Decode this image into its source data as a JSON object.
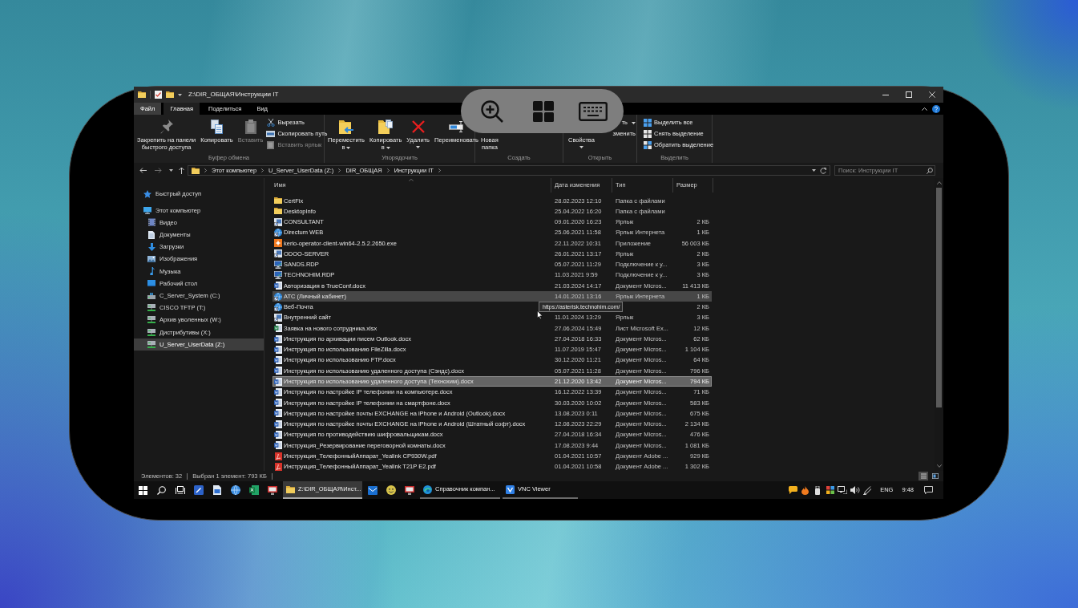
{
  "window": {
    "title": "Z:\\DIR_ОБЩАЯ\\Инструкции IT"
  },
  "ribbon": {
    "tabs": [
      {
        "label": "Файл",
        "kind": "file",
        "selected": false
      },
      {
        "label": "Главная",
        "kind": "tab",
        "selected": true
      },
      {
        "label": "Поделиться",
        "kind": "tab",
        "selected": false
      },
      {
        "label": "Вид",
        "kind": "tab",
        "selected": false
      }
    ],
    "groups": [
      {
        "label": "Буфер обмена",
        "large": [
          {
            "label": "Закрепить на панели\nбыстрого доступа",
            "kind": "pin",
            "disabled": false
          },
          {
            "label": "Копировать",
            "kind": "copy",
            "disabled": false
          },
          {
            "label": "Вставить",
            "kind": "paste",
            "disabled": true
          }
        ],
        "small": [
          {
            "label": "Вырезать",
            "kind": "cut",
            "disabled": false
          },
          {
            "label": "Скопировать путь",
            "kind": "copy-path",
            "disabled": false
          },
          {
            "label": "Вставить ярлык",
            "kind": "paste-shortcut",
            "disabled": true
          }
        ]
      },
      {
        "label": "Упорядочить",
        "large": [
          {
            "label": "Переместить\nв",
            "kind": "move-to",
            "dropdown": true,
            "disabled": false
          },
          {
            "label": "Копировать\nв",
            "kind": "copy-to",
            "dropdown": true,
            "disabled": false
          },
          {
            "label": "Удалить",
            "kind": "delete",
            "dropdown": true,
            "disabled": false
          },
          {
            "label": "Переименовать",
            "kind": "rename",
            "disabled": false
          }
        ]
      },
      {
        "label": "Создать",
        "large": [
          {
            "label": "Новая\nпапка",
            "disabled": false
          }
        ]
      },
      {
        "label": "Открыть",
        "large": [
          {
            "label": "Свойства",
            "dropdown": true,
            "disabled": false
          }
        ],
        "small": [
          {
            "label": "ть",
            "dropdown": true,
            "disabled": false
          },
          {
            "label": "зменить",
            "disabled": false
          }
        ]
      },
      {
        "label": "Выделить",
        "small": [
          {
            "label": "Выделить все",
            "kind": "select-all",
            "disabled": false
          },
          {
            "label": "Снять выделение",
            "kind": "select-none",
            "disabled": false
          },
          {
            "label": "Обратить выделение",
            "kind": "invert-selection",
            "disabled": false
          }
        ]
      }
    ]
  },
  "address_bar": {
    "path": [
      "Этот компьютер",
      "U_Server_UserData (Z:)",
      "DIR_ОБЩАЯ",
      "Инструкции IT"
    ]
  },
  "search": {
    "placeholder": "Поиск: Инструкции IT"
  },
  "sidebar": {
    "items": [
      {
        "label": "Быстрый доступ",
        "kind": "quick",
        "selected": false
      },
      {
        "label": "Этот компьютер",
        "kind": "pc",
        "selected": false,
        "children": [
          {
            "label": "Видео",
            "kind": "video",
            "selected": false
          },
          {
            "label": "Документы",
            "kind": "docs",
            "selected": false
          },
          {
            "label": "Загрузки",
            "kind": "downloads",
            "selected": false
          },
          {
            "label": "Изображения",
            "kind": "pictures",
            "selected": false
          },
          {
            "label": "Музыка",
            "kind": "music",
            "selected": false
          },
          {
            "label": "Рабочий стол",
            "kind": "desktop",
            "selected": false
          },
          {
            "label": "C_Server_System (C:)",
            "kind": "drive",
            "selected": false
          },
          {
            "label": "CISCO TFTP (T:)",
            "kind": "netdrive",
            "selected": false
          },
          {
            "label": "Архив уволенных (W:)",
            "kind": "netdrive",
            "selected": false
          },
          {
            "label": "Дистрибутивы (X:)",
            "kind": "netdrive",
            "selected": false
          },
          {
            "label": "U_Server_UserData (Z:)",
            "kind": "netdrive",
            "selected": true
          }
        ]
      }
    ]
  },
  "file_list": {
    "columns": [
      "Имя",
      "Дата изменения",
      "Тип",
      "Размер"
    ],
    "rows": [
      {
        "name": "CertFix",
        "date": "28.02.2023 12:10",
        "type": "Папка с файлами",
        "kind": "folder",
        "selected": false,
        "hovered": false
      },
      {
        "name": "DesktopInfo",
        "date": "25.04.2022 16:20",
        "type": "Папка с файлами",
        "kind": "folder",
        "selected": false,
        "hovered": false
      },
      {
        "name": "CONSULTANT",
        "date": "09.01.2020 16:23",
        "type": "Ярлык",
        "size": "2 КБ",
        "kind": "shortcut",
        "selected": false,
        "hovered": false
      },
      {
        "name": "Directum WEB",
        "date": "25.06.2021 11:58",
        "type": "Ярлык Интернета",
        "size": "1 КБ",
        "kind": "web-shortcut",
        "selected": false,
        "hovered": false
      },
      {
        "name": "kerio-operator-client-win64-2.5.2.2650.exe",
        "date": "22.11.2022 10:31",
        "type": "Приложение",
        "size": "56 003 КБ",
        "kind": "app",
        "selected": false,
        "hovered": false
      },
      {
        "name": "ODOO-SERVER",
        "date": "26.01.2021 13:17",
        "type": "Ярлык",
        "size": "2 КБ",
        "kind": "shortcut",
        "selected": false,
        "hovered": false
      },
      {
        "name": "SANDS.RDP",
        "date": "05.07.2021 11:29",
        "type": "Подключение к у...",
        "size": "3 КБ",
        "kind": "remote-desktop",
        "selected": false,
        "hovered": false
      },
      {
        "name": "TECHNOHIM.RDP",
        "date": "11.03.2021 9:59",
        "type": "Подключение к у...",
        "size": "3 КБ",
        "kind": "remote-desktop",
        "selected": false,
        "hovered": false
      },
      {
        "name": "Авторизация в TrueConf.docx",
        "date": "21.03.2024 14:17",
        "type": "Документ Micros...",
        "size": "11 413 КБ",
        "kind": "document",
        "selected": false,
        "hovered": false
      },
      {
        "name": "АТС (Личный кабинет)",
        "date": "14.01.2021 13:16",
        "type": "Ярлык Интернета",
        "size": "1 КБ",
        "kind": "web-shortcut",
        "selected": false,
        "hovered": true
      },
      {
        "name": "Веб-Почта",
        "size": "2 КБ",
        "kind": "web-shortcut",
        "selected": false,
        "hovered": false
      },
      {
        "name": "Внутренний сайт",
        "date": "11.01.2024 13:29",
        "type": "Ярлык",
        "size": "3 КБ",
        "kind": "shortcut",
        "selected": false,
        "hovered": false
      },
      {
        "name": "Заявка на нового сотрудника.xlsx",
        "date": "27.06.2024 15:49",
        "type": "Лист Microsoft Ex...",
        "size": "12 КБ",
        "kind": "spreadsheet",
        "selected": false,
        "hovered": false
      },
      {
        "name": "Инструкция по архивации писем Outlook.docx",
        "date": "27.04.2018 16:33",
        "type": "Документ Micros...",
        "size": "62 КБ",
        "kind": "document",
        "selected": false,
        "hovered": false
      },
      {
        "name": "Инструкция по использованию FileZilla.docx",
        "date": "11.07.2019 15:47",
        "type": "Документ Micros...",
        "size": "1 104 КБ",
        "kind": "document",
        "selected": false,
        "hovered": false
      },
      {
        "name": "Инструкция по использованию FTP.docx",
        "date": "30.12.2020 11:21",
        "type": "Документ Micros...",
        "size": "64 КБ",
        "kind": "document",
        "selected": false,
        "hovered": false
      },
      {
        "name": "Инструкция по использованию удаленного доступа (Сэндс).docx",
        "date": "05.07.2021 11:28",
        "type": "Документ Micros...",
        "size": "796 КБ",
        "kind": "document",
        "selected": false,
        "hovered": false
      },
      {
        "name": "Инструкция по использованию удаленного доступа (Технохим).docx",
        "date": "21.12.2020 13:42",
        "type": "Документ Micros...",
        "size": "794 КБ",
        "kind": "document",
        "selected": true,
        "hovered": false
      },
      {
        "name": "Инструкция по настройке IP телефонии на компьютере.docx",
        "date": "16.12.2022 13:39",
        "type": "Документ Micros...",
        "size": "71 КБ",
        "kind": "document",
        "selected": false,
        "hovered": false
      },
      {
        "name": "Инструкция по настройке IP телефонии на смартфоне.docx",
        "date": "30.03.2020 10:02",
        "type": "Документ Micros...",
        "size": "583 КБ",
        "kind": "document",
        "selected": false,
        "hovered": false
      },
      {
        "name": "Инструкция по настройке почты EXCHANGE на iPhone и Android (Outlook).docx",
        "date": "13.08.2023 0:11",
        "type": "Документ Micros...",
        "size": "675 КБ",
        "kind": "document",
        "selected": false,
        "hovered": false
      },
      {
        "name": "Инструкция по настройке почты EXCHANGE на iPhone и Android (Штатный софт).docx",
        "date": "12.08.2023 22:29",
        "type": "Документ Micros...",
        "size": "2 134 КБ",
        "kind": "document",
        "selected": false,
        "hovered": false
      },
      {
        "name": "Инструкция по противодействию шифровальщикам.docx",
        "date": "27.04.2018 16:34",
        "type": "Документ Micros...",
        "size": "476 КБ",
        "kind": "document",
        "selected": false,
        "hovered": false
      },
      {
        "name": "Инструкция_Резервирование переговорной комнаты.docx",
        "date": "17.08.2023 9:44",
        "type": "Документ Micros...",
        "size": "1 081 КБ",
        "kind": "document",
        "selected": false,
        "hovered": false
      },
      {
        "name": "Инструкция_ТелефонныйАппарат_Yealink CP930W.pdf",
        "date": "01.04.2021 10:57",
        "type": "Документ Adobe ...",
        "size": "929 КБ",
        "kind": "pdf",
        "selected": false,
        "hovered": false
      },
      {
        "name": "Инструкция_ТелефонныйАппарат_Yealink T21P E2.pdf",
        "date": "01.04.2021 10:58",
        "type": "Документ Adobe ...",
        "size": "1 302 КБ",
        "kind": "pdf",
        "selected": false,
        "hovered": false
      }
    ]
  },
  "tooltip": {
    "text": "https://asterisk.technohim.com/"
  },
  "status_bar": {
    "item_count": "Элементов: 32",
    "selection": "Выбран 1 элемент: 793 КБ",
    "views": [
      {
        "kind": "details",
        "selected": true
      },
      {
        "kind": "tiles",
        "selected": false
      }
    ]
  },
  "taskbar": {
    "windows": [
      {
        "label": "Z:\\DIR_ОБЩАЯ\\Инст...",
        "kind": "explorer",
        "selected": true
      },
      {
        "label": "Справочник компан...",
        "kind": "browser",
        "selected": false
      },
      {
        "label": "VNC Viewer",
        "kind": "vnc",
        "selected": false
      }
    ],
    "language": "ENG",
    "time": "9:48"
  }
}
